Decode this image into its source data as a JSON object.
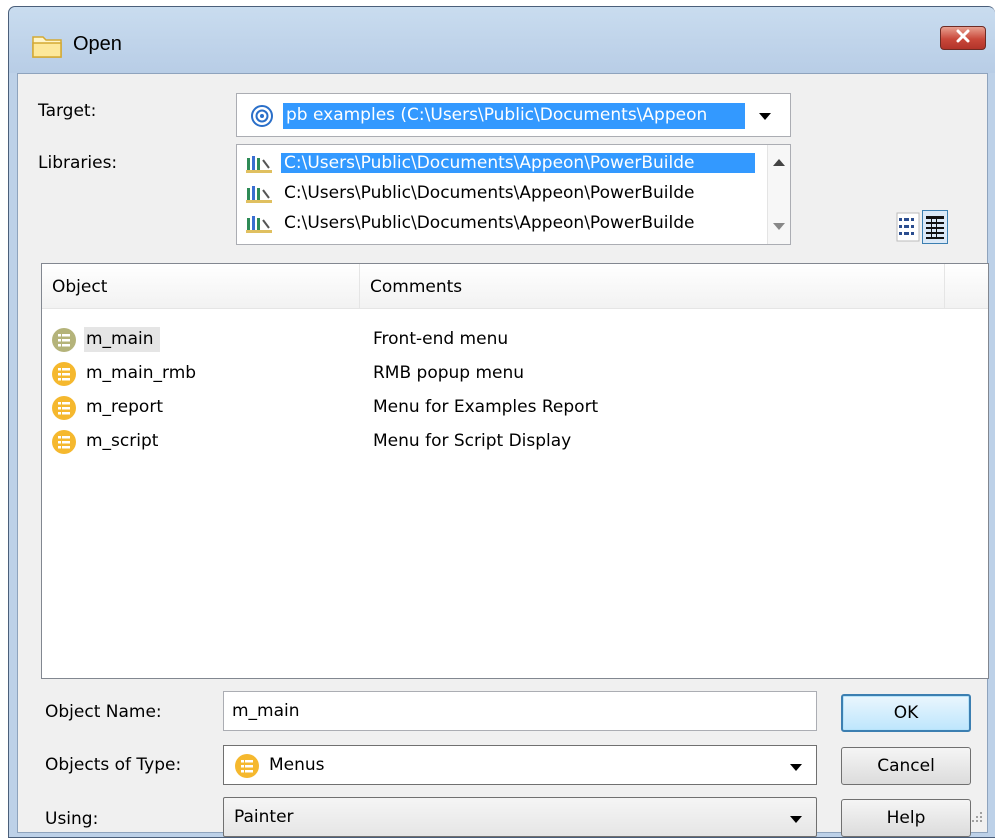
{
  "window": {
    "title": "Open",
    "close_icon": "close-icon"
  },
  "target": {
    "label": "Target:",
    "value": "pb examples (C:\\Users\\Public\\Documents\\Appeon",
    "icon": "target-icon"
  },
  "libraries": {
    "label": "Libraries:",
    "items": [
      {
        "path": "C:\\Users\\Public\\Documents\\Appeon\\PowerBuilde",
        "selected": true
      },
      {
        "path": "C:\\Users\\Public\\Documents\\Appeon\\PowerBuilde",
        "selected": false
      },
      {
        "path": "C:\\Users\\Public\\Documents\\Appeon\\PowerBuilde",
        "selected": false
      }
    ]
  },
  "list": {
    "columns": [
      "Object",
      "Comments"
    ],
    "rows": [
      {
        "name": "m_main",
        "comment": "Front-end menu"
      },
      {
        "name": "m_main_rmb",
        "comment": "RMB popup menu"
      },
      {
        "name": "m_report",
        "comment": "Menu for Examples Report"
      },
      {
        "name": "m_script",
        "comment": "Menu for Script Display"
      }
    ]
  },
  "form": {
    "object_name_label": "Object Name:",
    "object_name_value": "m_main",
    "objects_type_label": "Objects of Type:",
    "objects_type_value": "Menus",
    "using_label": "Using:",
    "using_value": "Painter"
  },
  "buttons": {
    "ok": "OK",
    "cancel": "Cancel",
    "help": "Help"
  },
  "colors": {
    "selection": "#3399ff",
    "menu_icon": "#f5b82e",
    "dialog_bg": "#f0f0f0"
  }
}
